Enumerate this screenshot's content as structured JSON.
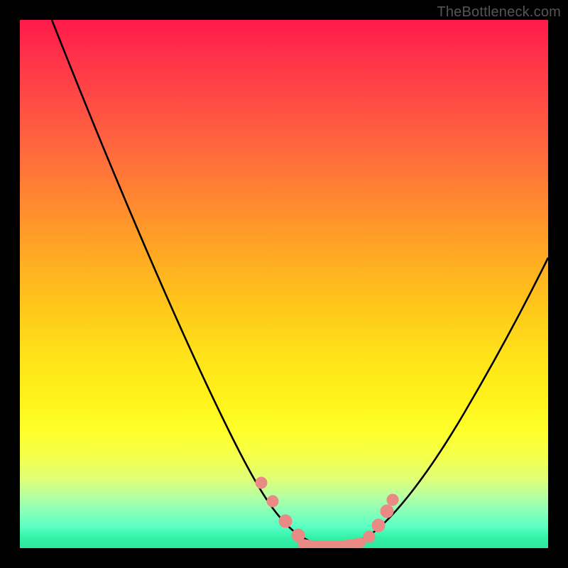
{
  "watermark": {
    "text": "TheBottleneck.com"
  },
  "chart_data": {
    "type": "line",
    "title": "",
    "xlabel": "",
    "ylabel": "",
    "xlim": [
      0,
      100
    ],
    "ylim": [
      0,
      100
    ],
    "grid": false,
    "legend": false,
    "background_gradient": {
      "direction": "top-to-bottom",
      "stops": [
        {
          "pos": 0.0,
          "color": "#ff1a4a"
        },
        {
          "pos": 0.5,
          "color": "#ffc91a"
        },
        {
          "pos": 0.8,
          "color": "#feff2b"
        },
        {
          "pos": 1.0,
          "color": "#2de79b"
        }
      ]
    },
    "series": [
      {
        "name": "bottleneck-curve",
        "color": "#000000",
        "x": [
          6,
          10,
          15,
          20,
          25,
          30,
          35,
          40,
          44,
          48,
          52,
          55,
          58,
          60,
          63,
          66,
          70,
          75,
          80,
          85,
          90,
          95,
          100
        ],
        "y": [
          100,
          92,
          82,
          72,
          62,
          52,
          42,
          32,
          23,
          14,
          6,
          2,
          0,
          0,
          0,
          2,
          8,
          17,
          27,
          36,
          44,
          51,
          58
        ]
      },
      {
        "name": "marker-dots",
        "color": "#e98a84",
        "type": "scatter",
        "x": [
          44.5,
          47.5,
          50,
          53,
          57,
          60,
          63,
          65.5,
          67.5,
          69
        ],
        "y": [
          14,
          8,
          3.5,
          1,
          0,
          0,
          0.5,
          2,
          5,
          9
        ]
      }
    ]
  }
}
